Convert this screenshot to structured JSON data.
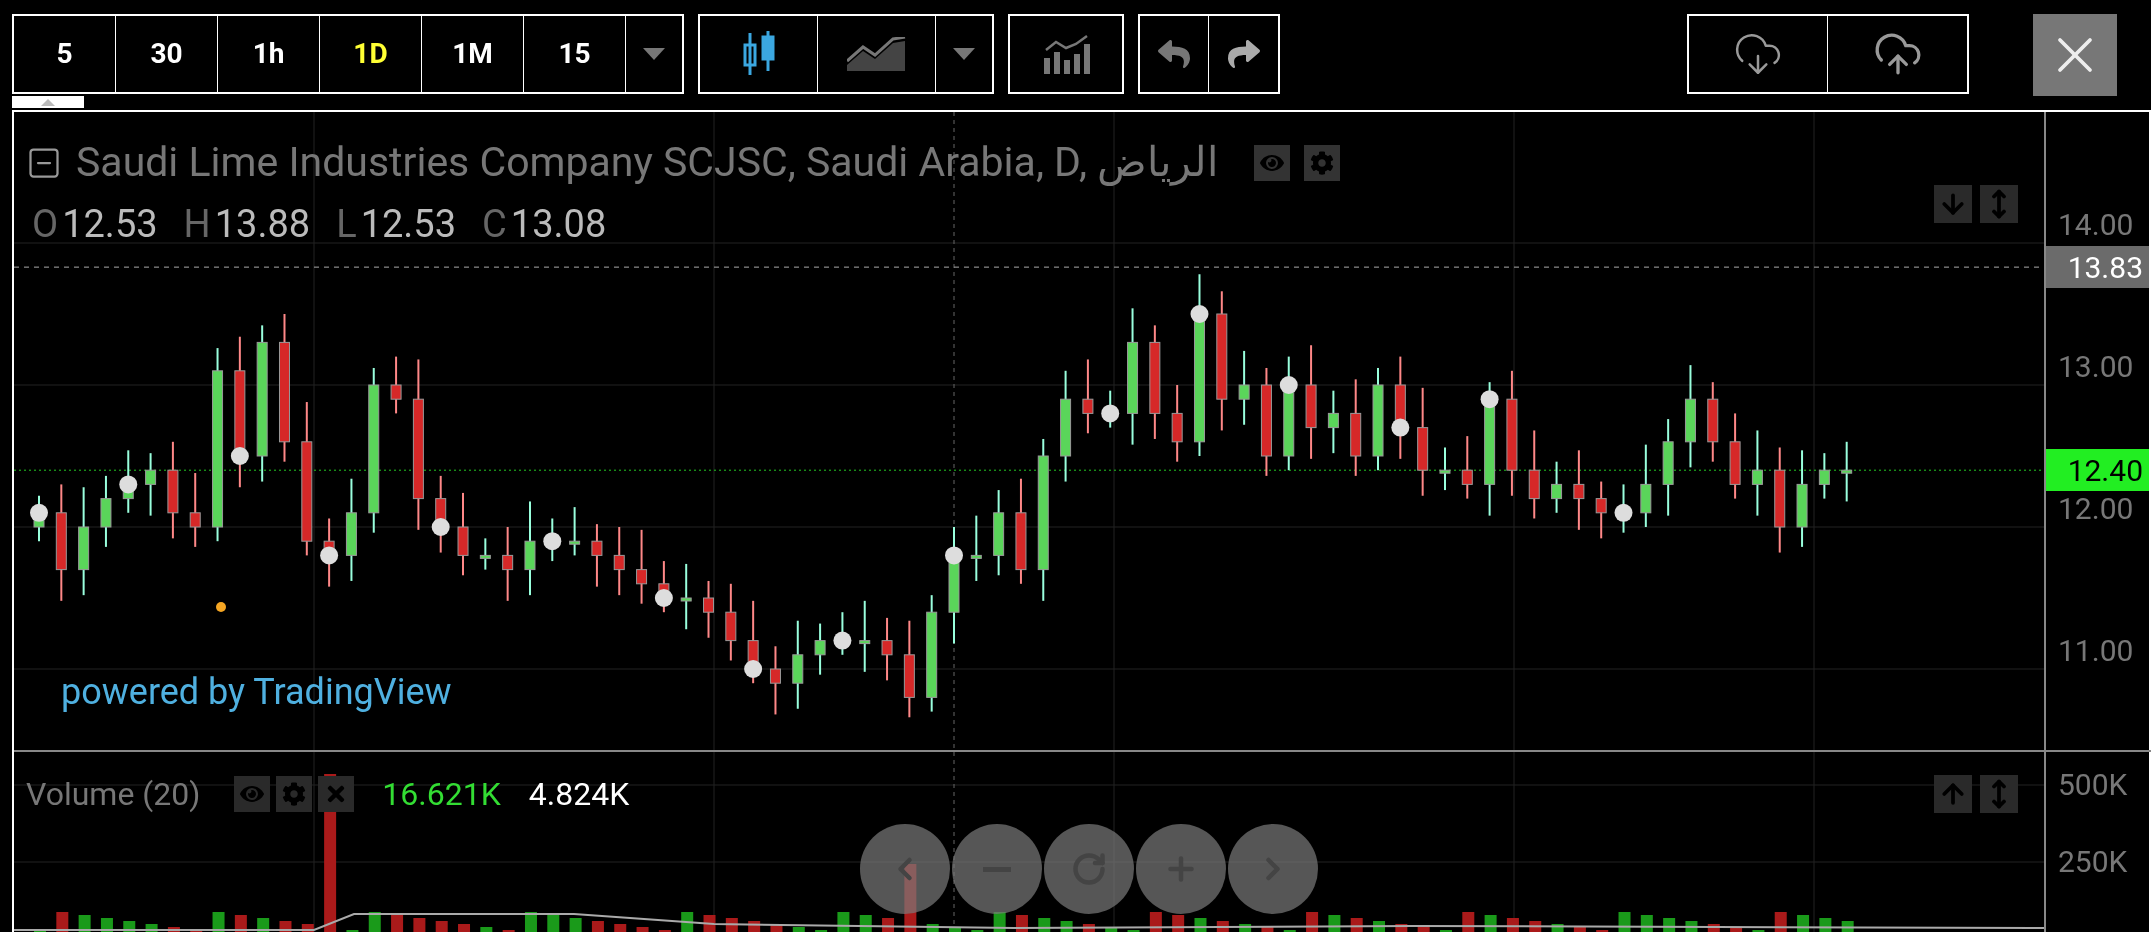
{
  "toolbar": {
    "intervals": [
      {
        "label": "5",
        "selected": false
      },
      {
        "label": "30",
        "selected": false
      },
      {
        "label": "1h",
        "selected": false
      },
      {
        "label": "1D",
        "selected": true
      },
      {
        "label": "1M",
        "selected": false
      },
      {
        "label": "15",
        "selected": false
      }
    ],
    "chart_styles": [
      {
        "kind": "candles",
        "selected": true
      },
      {
        "kind": "area",
        "selected": false
      }
    ]
  },
  "symbol": {
    "title": "Saudi Lime Industries Company SCJSC, Saudi Arabia, D, الرياض",
    "ohlc": [
      {
        "label": "O",
        "value": "12.53"
      },
      {
        "label": "H",
        "value": "13.88"
      },
      {
        "label": "L",
        "value": "12.53"
      },
      {
        "label": "C",
        "value": "13.08"
      }
    ]
  },
  "price_axis": {
    "ticks": [
      "14.00",
      "13.00",
      "12.00",
      "11.00"
    ],
    "markers": [
      {
        "value": "13.83",
        "kind": "high"
      },
      {
        "value": "12.40",
        "kind": "last"
      }
    ]
  },
  "branding": "powered by TradingView",
  "volume": {
    "title": "Volume (20)",
    "values": [
      {
        "value": "16.621K",
        "kind": "up"
      },
      {
        "value": "4.824K",
        "kind": "plain"
      }
    ],
    "ticks": [
      "500K",
      "250K"
    ]
  }
}
